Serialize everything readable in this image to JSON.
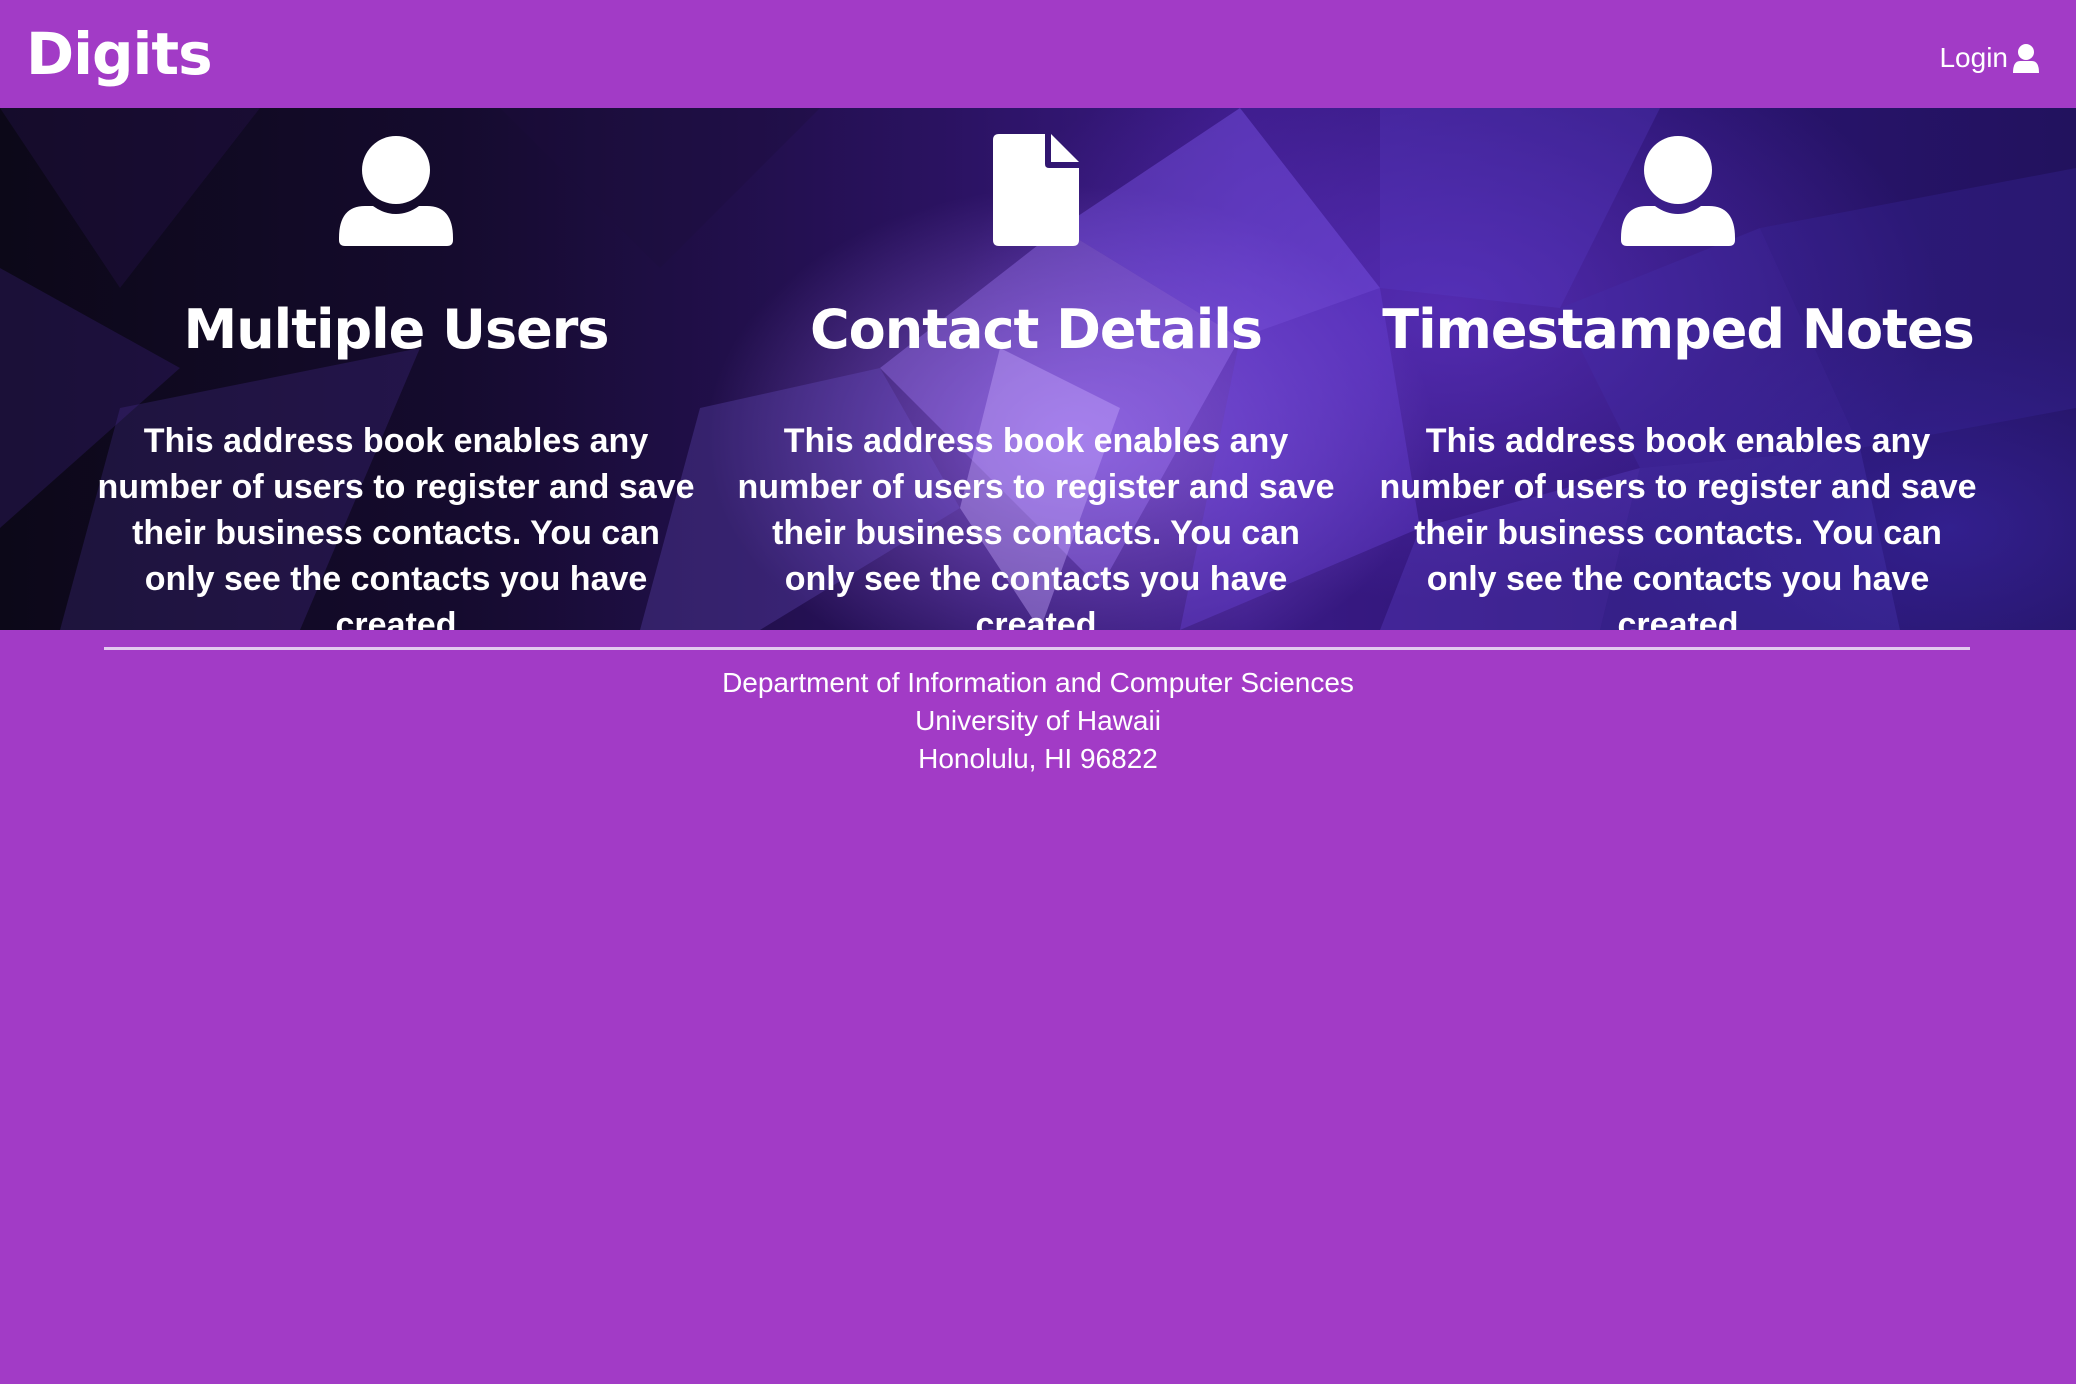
{
  "navbar": {
    "brand": "Digits",
    "login_label": "Login",
    "login_icon": "user-icon"
  },
  "features": [
    {
      "icon": "user-icon",
      "title": "Multiple Users",
      "text": "This address book enables any number of users to register and save their business contacts. You can only see the contacts you have created"
    },
    {
      "icon": "file-icon",
      "title": "Contact Details",
      "text": "This address book enables any number of users to register and save their business contacts. You can only see the contacts you have created"
    },
    {
      "icon": "user-icon",
      "title": "Timestamped Notes",
      "text": "This address book enables any number of users to register and save their business contacts. You can only see the contacts you have created"
    }
  ],
  "footer": {
    "line1": "Department of Information and Computer Sciences",
    "line2": "University of Hawaii",
    "line3": "Honolulu, HI 96822"
  },
  "colors": {
    "page_background": "#a23bc6",
    "hero_dark": "#150b2e",
    "hero_accent": "#7a4ae6",
    "text": "#ffffff"
  }
}
